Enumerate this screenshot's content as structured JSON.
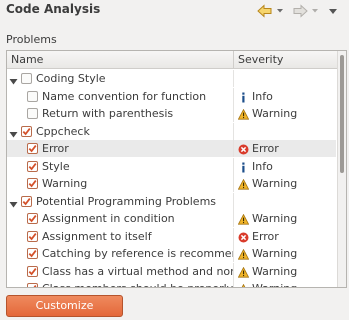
{
  "header": {
    "title": "Code Analysis"
  },
  "section_label": "Problems",
  "columns": {
    "name": "Name",
    "severity": "Severity"
  },
  "rows": [
    {
      "label": "Coding Style",
      "severity": "",
      "sev_kind": "",
      "level": 0,
      "group": true,
      "checked": false
    },
    {
      "label": "Name convention for function",
      "severity": "Info",
      "sev_kind": "info",
      "level": 1,
      "group": false,
      "checked": false
    },
    {
      "label": "Return with parenthesis",
      "severity": "Warning",
      "sev_kind": "warning",
      "level": 1,
      "group": false,
      "checked": false
    },
    {
      "label": "Cppcheck",
      "severity": "",
      "sev_kind": "",
      "level": 0,
      "group": true,
      "checked": true
    },
    {
      "label": "Error",
      "severity": "Error",
      "sev_kind": "error",
      "level": 1,
      "group": false,
      "checked": true,
      "selected": true
    },
    {
      "label": "Style",
      "severity": "Info",
      "sev_kind": "info",
      "level": 1,
      "group": false,
      "checked": true
    },
    {
      "label": "Warning",
      "severity": "Warning",
      "sev_kind": "warning",
      "level": 1,
      "group": false,
      "checked": true
    },
    {
      "label": "Potential Programming Problems",
      "severity": "",
      "sev_kind": "",
      "level": 0,
      "group": true,
      "checked": true
    },
    {
      "label": "Assignment in condition",
      "severity": "Warning",
      "sev_kind": "warning",
      "level": 1,
      "group": false,
      "checked": true
    },
    {
      "label": "Assignment to itself",
      "severity": "Error",
      "sev_kind": "error",
      "level": 1,
      "group": false,
      "checked": true
    },
    {
      "label": "Catching by reference is recommended",
      "severity": "Warning",
      "sev_kind": "warning",
      "level": 1,
      "group": false,
      "checked": true
    },
    {
      "label": "Class has a virtual method and non-virtual destructor",
      "severity": "Warning",
      "sev_kind": "warning",
      "level": 1,
      "group": false,
      "checked": true
    },
    {
      "label": "Class members should be properly initialized",
      "severity": "Warning",
      "sev_kind": "warning",
      "level": 1,
      "group": false,
      "checked": true
    }
  ],
  "button": {
    "label": "Customize Selected..."
  },
  "colors": {
    "accent": "#e4683a",
    "info": "#1c4e8a",
    "warning": "#f0b429",
    "error": "#d93b2b"
  }
}
